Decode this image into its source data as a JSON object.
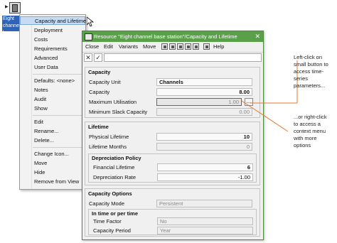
{
  "canvas": {
    "node_label": "Eight channel base station"
  },
  "context_menu": {
    "items": [
      "Capacity and Lifetime",
      "Deployment",
      "Costs",
      "Requirements",
      "Advanced",
      "User Data",
      "Defaults: <none>",
      "Notes",
      "Audit",
      "Show",
      "Edit",
      "Rename...",
      "Delete...",
      "Change Icon...",
      "Move",
      "Hide",
      "Remove from View"
    ],
    "highlighted_index": 0
  },
  "dialog": {
    "title": "Resource \"Eight channel base station\"/Capacity and Lifetime",
    "menu": [
      "Close",
      "Edit",
      "Variants",
      "Move",
      "Help"
    ],
    "capacity": {
      "title": "Capacity",
      "unit_label": "Capacity Unit",
      "unit_value": "Channels",
      "capacity_label": "Capacity",
      "capacity_value": "8.00",
      "max_util_label": "Maximum Utilisation",
      "max_util_value": "1.00",
      "min_slack_label": "Minimum Slack Capacity",
      "min_slack_value": "0.00"
    },
    "lifetime": {
      "title": "Lifetime",
      "physical_label": "Physical Lifetime",
      "physical_value": "10",
      "months_label": "Lifetime Months",
      "months_value": "0",
      "depr_title": "Depreciation Policy",
      "financial_label": "Financial Lifetime",
      "financial_value": "6",
      "rate_label": "Depreciation Rate",
      "rate_value": "-1.00"
    },
    "options": {
      "title": "Capacity Options",
      "mode_label": "Capacity Mode",
      "mode_value": "Persistent",
      "time_title": "In time or per time",
      "factor_label": "Time Factor",
      "factor_value": "No",
      "period_label": "Capacity Period",
      "period_value": "Year"
    }
  },
  "callouts": {
    "top": [
      "Left-click on",
      "small button to",
      "access time-",
      "series",
      "parameters..."
    ],
    "bottom": [
      "...or right-click",
      "to access a",
      "context menu",
      "with more",
      "options"
    ]
  }
}
